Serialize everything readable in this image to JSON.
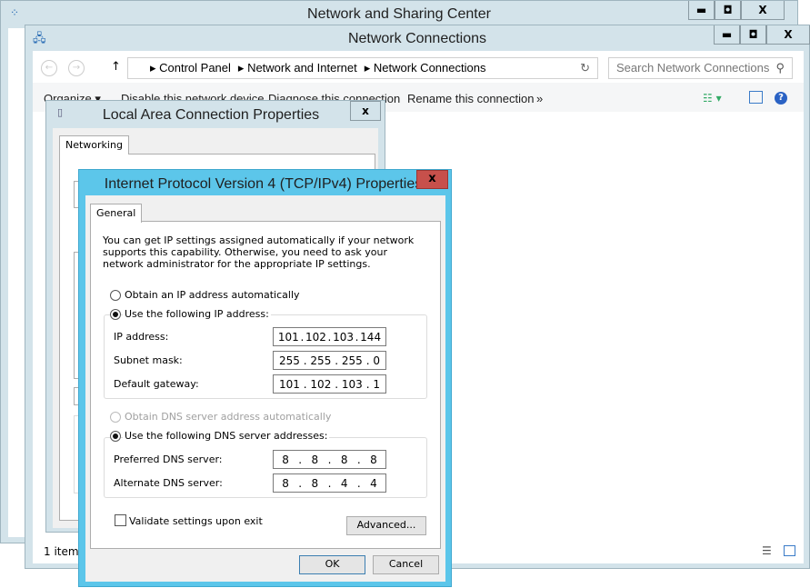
{
  "sharing_center": {
    "title": "Network and Sharing Center",
    "controls": [
      "▬",
      "◘",
      "X"
    ]
  },
  "connections": {
    "title": "Network Connections",
    "controls": [
      "▬",
      "◘",
      "X"
    ],
    "breadcrumb": [
      "Control Panel",
      "Network and Internet",
      "Network Connections"
    ],
    "search_placeholder": "Search Network Connections",
    "commands": [
      "Organize ▾",
      "Disable this network device",
      "Diagnose this connection",
      "Rename this connection",
      "»"
    ],
    "status": "1 item"
  },
  "lan_props": {
    "title": "Local Area Connection Properties",
    "close": "x",
    "tab": "Networking"
  },
  "ipv4": {
    "title": "Internet Protocol Version 4 (TCP/IPv4) Properties",
    "close": "x",
    "tab": "General",
    "description": "You can get IP settings assigned automatically if your network supports this capability. Otherwise, you need to ask your network administrator for the appropriate IP settings.",
    "obtain_ip_auto": "Obtain an IP address automatically",
    "use_ip": "Use the following IP address:",
    "ip_label": "IP address:",
    "ip": [
      "101",
      "102",
      "103",
      "144"
    ],
    "mask_label": "Subnet mask:",
    "mask": [
      "255",
      "255",
      "255",
      "0"
    ],
    "gw_label": "Default gateway:",
    "gw": [
      "101",
      "102",
      "103",
      "1"
    ],
    "obtain_dns_auto": "Obtain DNS server address automatically",
    "use_dns": "Use the following DNS server addresses:",
    "pref_label": "Preferred DNS server:",
    "pref": [
      "8",
      "8",
      "8",
      "8"
    ],
    "alt_label": "Alternate DNS server:",
    "alt": [
      "8",
      "8",
      "4",
      "4"
    ],
    "validate": "Validate settings upon exit",
    "validate_checked": false,
    "advanced": "Advanced...",
    "ok": "OK",
    "cancel": "Cancel",
    "accent": "#5cc6ea"
  }
}
